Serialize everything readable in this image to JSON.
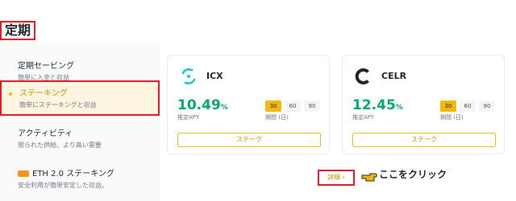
{
  "page": {
    "title": "定期"
  },
  "sidebar": {
    "items": [
      {
        "title": "定期セービング",
        "subtitle": "簡単に入金と収益"
      },
      {
        "title": "ステーキング",
        "subtitle": "簡単にステーキングと収益"
      },
      {
        "title": "アクティビティ",
        "subtitle": "限られた供給、より高い需要"
      },
      {
        "badge_icon": "eth2-badge-icon",
        "title": "ETH 2.0 ステーキング",
        "subtitle": "安全利用が簡単安定した収益。"
      }
    ],
    "active_index": 1
  },
  "cards": [
    {
      "coin": "ICX",
      "logo_icon": "icx-logo-icon",
      "apy_value": "10.49",
      "apy_unit": "%",
      "apy_label": "推定APY",
      "durations": [
        "30",
        "60",
        "90"
      ],
      "selected_duration": "30",
      "period_label": "期間 (日)",
      "stake_label": "ステーク"
    },
    {
      "coin": "CELR",
      "logo_icon": "celr-logo-icon",
      "apy_value": "12.45",
      "apy_unit": "%",
      "apy_label": "推定APY",
      "durations": [
        "30",
        "60",
        "90"
      ],
      "selected_duration": "30",
      "period_label": "期間 (日)",
      "stake_label": "ステーク"
    }
  ],
  "details_link": "詳細 ›",
  "annotation": {
    "icon": "pointing-hand-icon",
    "text": "ここをクリック"
  },
  "colors": {
    "highlight_border": "#e0192a",
    "accent": "#f0b90b",
    "apy_green": "#03a66d",
    "active_bg": "#fdf5e0"
  }
}
